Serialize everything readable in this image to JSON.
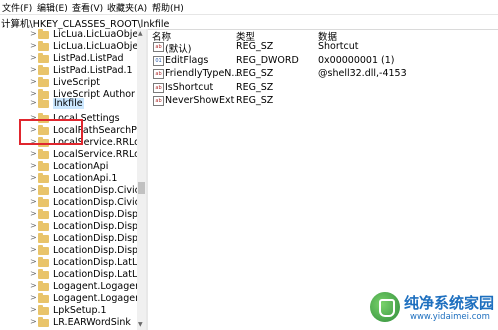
{
  "menu": [
    "文件(F)",
    "编辑(E)",
    "查看(V)",
    "收藏夹(A)",
    "帮助(H)"
  ],
  "address": "计算机\\HKEY_CLASSES_ROOT\\lnkfile",
  "tree": {
    "items": [
      {
        "label": "LicLua.LicLuaObject"
      },
      {
        "label": "LicLua.LicLuaObject."
      },
      {
        "label": "ListPad.ListPad"
      },
      {
        "label": "ListPad.ListPad.1"
      },
      {
        "label": "LiveScript"
      },
      {
        "label": "LiveScript Author"
      },
      {
        "label": "lnkfile"
      },
      {
        "label": "Local Settings"
      },
      {
        "label": "LocalPathSearchProv"
      },
      {
        "label": "LocalService.RRLoca"
      },
      {
        "label": "LocalService.RRLoca"
      },
      {
        "label": "LocationApi"
      },
      {
        "label": "LocationApi.1"
      },
      {
        "label": "LocationDisp.CivicA"
      },
      {
        "label": "LocationDisp.CivicA"
      },
      {
        "label": "LocationDisp.DispCi"
      },
      {
        "label": "LocationDisp.DispCi"
      },
      {
        "label": "LocationDisp.DispLa"
      },
      {
        "label": "LocationDisp.DispLa"
      },
      {
        "label": "LocationDisp.LatLon"
      },
      {
        "label": "LocationDisp.LatLon"
      },
      {
        "label": "Logagent.Logagent"
      },
      {
        "label": "Logagent.Logagent."
      },
      {
        "label": "LpkSetup.1"
      },
      {
        "label": "LR.EARWordSink"
      }
    ]
  },
  "list": {
    "headers": {
      "name": "名称",
      "type": "类型",
      "data": "数据"
    },
    "rows": [
      {
        "name": "(默认)",
        "type": "REG_SZ",
        "data": "Shortcut",
        "icon": "string-value-icon"
      },
      {
        "name": "EditFlags",
        "type": "REG_DWORD",
        "data": "0x00000001 (1)",
        "icon": "binary-value-icon"
      },
      {
        "name": "FriendlyTypeN...",
        "type": "REG_SZ",
        "data": "@shell32.dll,-4153",
        "icon": "string-value-icon"
      },
      {
        "name": "IsShortcut",
        "type": "REG_SZ",
        "data": "",
        "icon": "string-value-icon"
      },
      {
        "name": "NeverShowExt",
        "type": "REG_SZ",
        "data": "",
        "icon": "string-value-icon"
      }
    ]
  },
  "watermark": {
    "title": "纯净系统家园",
    "url": "www.yidaimei.com"
  },
  "colors": {
    "selection": "#cce8ff",
    "highlight_box": "#e0262e",
    "folder": "#e9c46a",
    "watermark": "#1d6fbf"
  }
}
